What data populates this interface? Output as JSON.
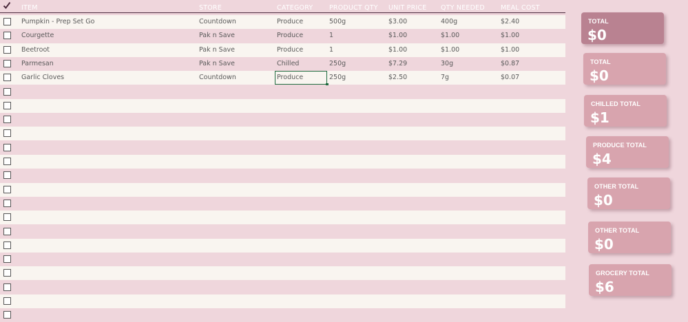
{
  "header": {
    "columns": [
      "ITEM",
      "STORE",
      "CATEGORY",
      "PRODUCT QTY",
      "UNIT PRICE",
      "QTY NEEDED",
      "MEAL COST"
    ]
  },
  "rows": [
    {
      "checked": false,
      "item": "Pumpkin - Prep Set Go",
      "store": "Countdown",
      "category": "Produce",
      "product_qty": "500g",
      "unit_price": "$3.00",
      "qty_needed": "400g",
      "meal_cost": "$2.40"
    },
    {
      "checked": false,
      "item": "Courgette",
      "store": "Pak n Save",
      "category": "Produce",
      "product_qty": "1",
      "unit_price": "$1.00",
      "qty_needed": "$1.00",
      "meal_cost": "$1.00"
    },
    {
      "checked": false,
      "item": "Beetroot",
      "store": "Pak n Save",
      "category": "Produce",
      "product_qty": "1",
      "unit_price": "$1.00",
      "qty_needed": "$1.00",
      "meal_cost": "$1.00"
    },
    {
      "checked": false,
      "item": "Parmesan",
      "store": "Pak n Save",
      "category": "Chilled",
      "product_qty": "250g",
      "unit_price": "$7.29",
      "qty_needed": "30g",
      "meal_cost": "$0.87"
    },
    {
      "checked": false,
      "item": "Garlic Cloves",
      "store": "Countdown",
      "category": "Produce",
      "product_qty": "250g",
      "unit_price": "$2.50",
      "qty_needed": "7g",
      "meal_cost": "$0.07"
    },
    {
      "checked": false,
      "item": "",
      "store": "",
      "category": "",
      "product_qty": "",
      "unit_price": "",
      "qty_needed": "",
      "meal_cost": ""
    },
    {
      "checked": false,
      "item": "",
      "store": "",
      "category": "",
      "product_qty": "",
      "unit_price": "",
      "qty_needed": "",
      "meal_cost": ""
    },
    {
      "checked": false,
      "item": "",
      "store": "",
      "category": "",
      "product_qty": "",
      "unit_price": "",
      "qty_needed": "",
      "meal_cost": ""
    },
    {
      "checked": false,
      "item": "",
      "store": "",
      "category": "",
      "product_qty": "",
      "unit_price": "",
      "qty_needed": "",
      "meal_cost": ""
    },
    {
      "checked": false,
      "item": "",
      "store": "",
      "category": "",
      "product_qty": "",
      "unit_price": "",
      "qty_needed": "",
      "meal_cost": ""
    },
    {
      "checked": false,
      "item": "",
      "store": "",
      "category": "",
      "product_qty": "",
      "unit_price": "",
      "qty_needed": "",
      "meal_cost": ""
    },
    {
      "checked": false,
      "item": "",
      "store": "",
      "category": "",
      "product_qty": "",
      "unit_price": "",
      "qty_needed": "",
      "meal_cost": ""
    },
    {
      "checked": false,
      "item": "",
      "store": "",
      "category": "",
      "product_qty": "",
      "unit_price": "",
      "qty_needed": "",
      "meal_cost": ""
    },
    {
      "checked": false,
      "item": "",
      "store": "",
      "category": "",
      "product_qty": "",
      "unit_price": "",
      "qty_needed": "",
      "meal_cost": ""
    },
    {
      "checked": false,
      "item": "",
      "store": "",
      "category": "",
      "product_qty": "",
      "unit_price": "",
      "qty_needed": "",
      "meal_cost": ""
    },
    {
      "checked": false,
      "item": "",
      "store": "",
      "category": "",
      "product_qty": "",
      "unit_price": "",
      "qty_needed": "",
      "meal_cost": ""
    },
    {
      "checked": false,
      "item": "",
      "store": "",
      "category": "",
      "product_qty": "",
      "unit_price": "",
      "qty_needed": "",
      "meal_cost": ""
    },
    {
      "checked": false,
      "item": "",
      "store": "",
      "category": "",
      "product_qty": "",
      "unit_price": "",
      "qty_needed": "",
      "meal_cost": ""
    },
    {
      "checked": false,
      "item": "",
      "store": "",
      "category": "",
      "product_qty": "",
      "unit_price": "",
      "qty_needed": "",
      "meal_cost": ""
    },
    {
      "checked": false,
      "item": "",
      "store": "",
      "category": "",
      "product_qty": "",
      "unit_price": "",
      "qty_needed": "",
      "meal_cost": ""
    },
    {
      "checked": false,
      "item": "",
      "store": "",
      "category": "",
      "product_qty": "",
      "unit_price": "",
      "qty_needed": "",
      "meal_cost": ""
    },
    {
      "checked": false,
      "item": "",
      "store": "",
      "category": "",
      "product_qty": "",
      "unit_price": "",
      "qty_needed": "",
      "meal_cost": ""
    }
  ],
  "selected_cell": {
    "row": 4,
    "column": "category"
  },
  "summary_cards": [
    {
      "label": "TOTAL",
      "value": "$0"
    },
    {
      "label": "TOTAL",
      "value": "$0"
    },
    {
      "label": "CHILLED TOTAL",
      "value": "$1"
    },
    {
      "label": "PRODUCE TOTAL",
      "value": "$4"
    },
    {
      "label": "OTHER TOTAL",
      "value": "$0"
    },
    {
      "label": "OTHER TOTAL",
      "value": "$0"
    },
    {
      "label": "GROCERY TOTAL",
      "value": "$6"
    }
  ],
  "colors": {
    "row_light": "#f9f5f0",
    "row_pink": "#efd6dc",
    "card": "#d8a4ae",
    "card_dark": "#b98291",
    "header_rule": "#4b2a3c",
    "selection": "#1f6b3f"
  },
  "icons": {
    "header_check": "checkmark-icon",
    "row_check": "checkbox-icon"
  }
}
